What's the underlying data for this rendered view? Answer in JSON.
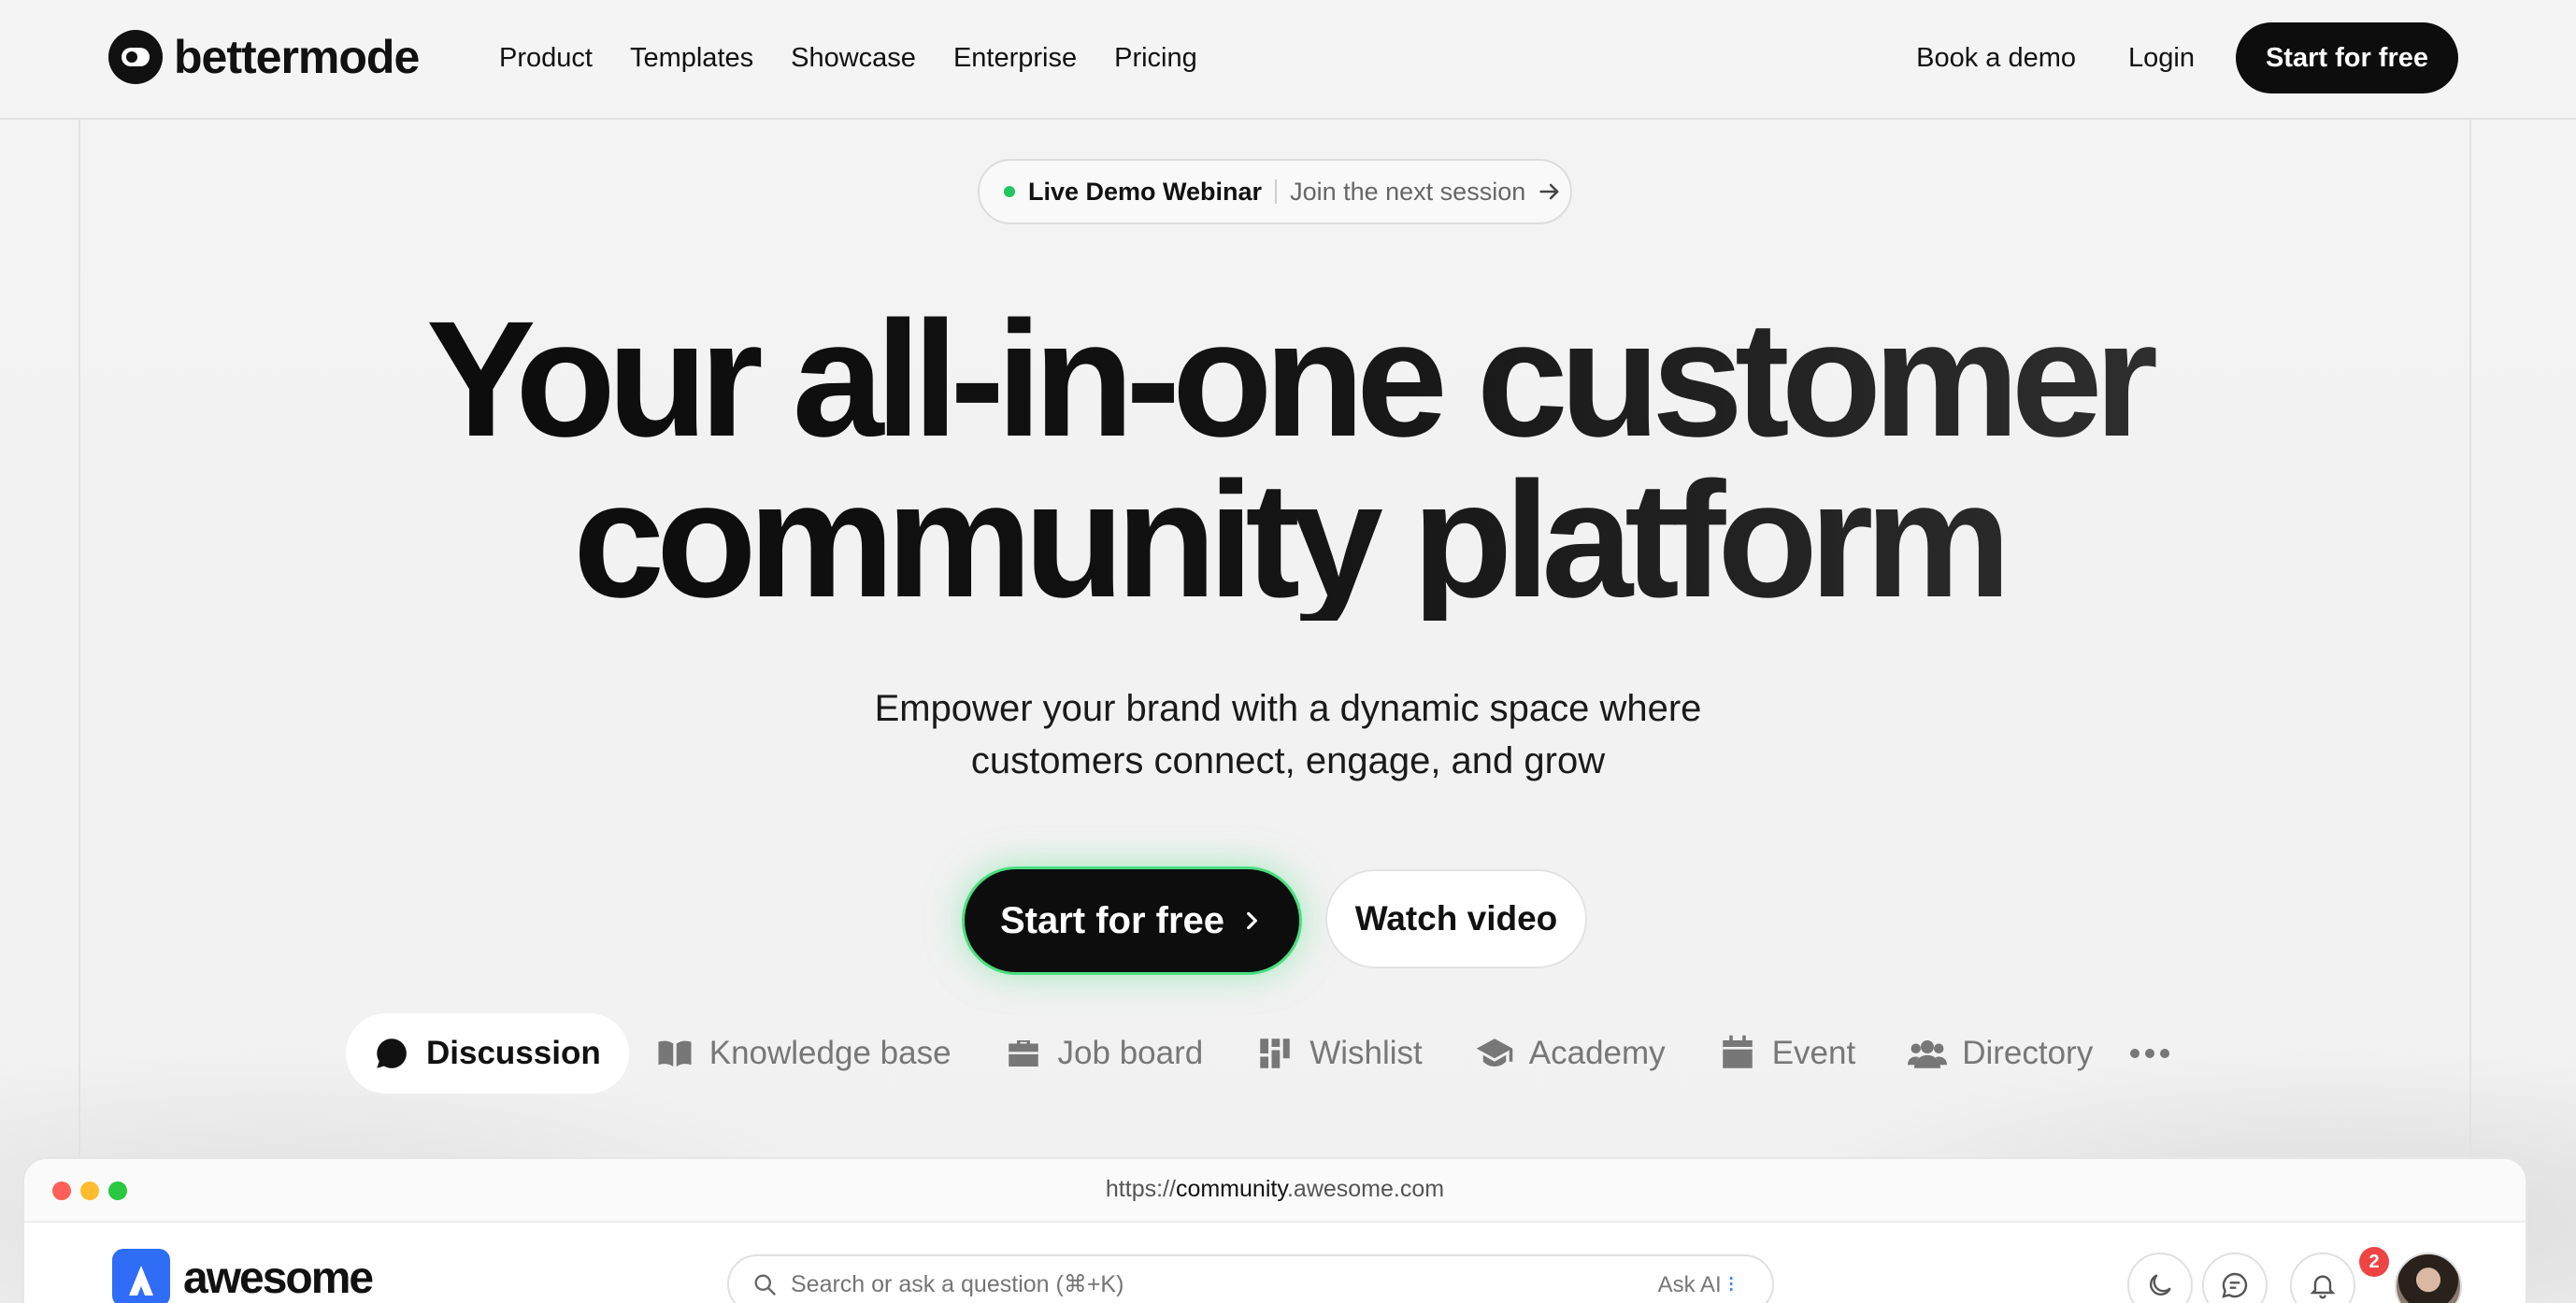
{
  "brand": {
    "name": "bettermode"
  },
  "nav": {
    "items": [
      "Product",
      "Templates",
      "Showcase",
      "Enterprise",
      "Pricing"
    ],
    "book_demo": "Book a demo",
    "login": "Login",
    "cta": "Start for free"
  },
  "announcement": {
    "title": "Live Demo Webinar",
    "subtitle": "Join the next session"
  },
  "hero": {
    "title_line1": "Your all-in-one customer",
    "title_line2": "community platform",
    "subtitle_line1": "Empower your brand with a dynamic space where",
    "subtitle_line2": "customers connect, engage, and grow",
    "primary_cta": "Start for free",
    "secondary_cta": "Watch video"
  },
  "tabs": [
    {
      "label": "Discussion",
      "icon": "chat-bubble-icon",
      "active": true
    },
    {
      "label": "Knowledge base",
      "icon": "book-icon",
      "active": false
    },
    {
      "label": "Job board",
      "icon": "briefcase-icon",
      "active": false
    },
    {
      "label": "Wishlist",
      "icon": "grid-icon",
      "active": false
    },
    {
      "label": "Academy",
      "icon": "graduation-cap-icon",
      "active": false
    },
    {
      "label": "Event",
      "icon": "calendar-icon",
      "active": false
    },
    {
      "label": "Directory",
      "icon": "people-icon",
      "active": false
    }
  ],
  "browser": {
    "url_prefix": "https://",
    "url_domain": "community",
    "url_suffix": ".awesome.com",
    "app_name": "awesome",
    "search_placeholder": "Search or ask a question (⌘+K)",
    "ask_ai": "Ask AI",
    "notification_count": "2"
  },
  "colors": {
    "accent_green": "#22c55e",
    "brand_blue": "#2f6df6",
    "badge_red": "#ef4444",
    "traffic_red": "#ff5f57",
    "traffic_yellow": "#febc2e",
    "traffic_green": "#28c840"
  }
}
